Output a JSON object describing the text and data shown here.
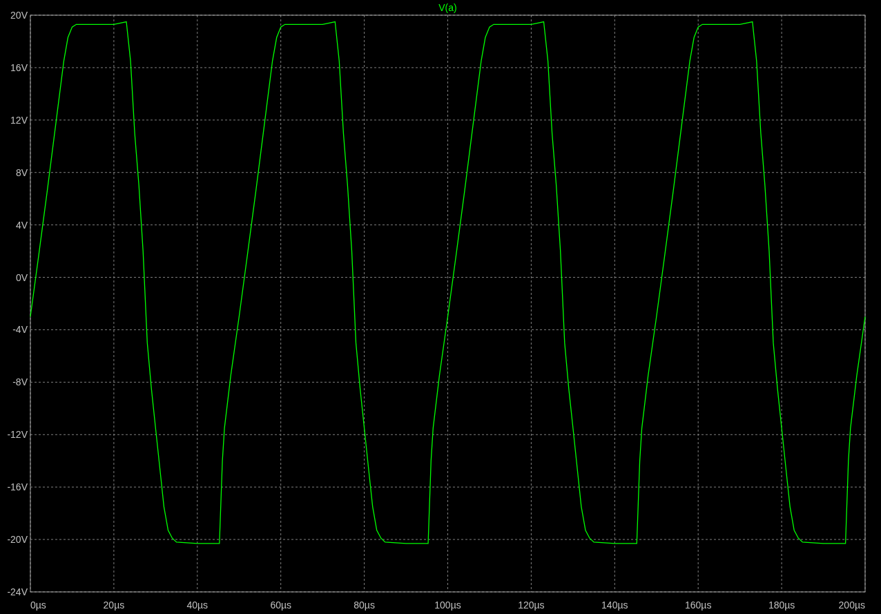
{
  "plot": {
    "chart_data": {
      "type": "line",
      "grid": true,
      "x": [
        0,
        2,
        4,
        6,
        8,
        9,
        10,
        11,
        15,
        20,
        23,
        24,
        25,
        26,
        27,
        28,
        29,
        30,
        31,
        32,
        33,
        34,
        35,
        40,
        45.3,
        46,
        46.5,
        48,
        50,
        52,
        54,
        56,
        58,
        59,
        60,
        61,
        65,
        70,
        73,
        74,
        75,
        76,
        77,
        78,
        79,
        80,
        81,
        82,
        83,
        84,
        85,
        90,
        95.3,
        96,
        96.5,
        98,
        100,
        102,
        104,
        106,
        108,
        109,
        110,
        111,
        115,
        120,
        123,
        124,
        125,
        126,
        127,
        128,
        129,
        130,
        131,
        132,
        133,
        134,
        135,
        140,
        145.3,
        146,
        146.5,
        148,
        150,
        152,
        154,
        156,
        158,
        159,
        160,
        161,
        165,
        170,
        173,
        174,
        175,
        176,
        177,
        178,
        179,
        180,
        181,
        182,
        183,
        184,
        185,
        190,
        195.3,
        196,
        196.5,
        198,
        200
      ],
      "series": [
        {
          "name": "V(a)",
          "color": "#00ff00",
          "values": [
            -3,
            1.7,
            6.5,
            11.5,
            16.5,
            18.3,
            19.1,
            19.3,
            19.3,
            19.3,
            19.5,
            16.5,
            11,
            7,
            2,
            -5,
            -8.5,
            -11.5,
            -14.5,
            -17.5,
            -19.3,
            -19.9,
            -20.2,
            -20.3,
            -20.3,
            -14,
            -11.5,
            -7.5,
            -3,
            1.7,
            6.5,
            11.5,
            16.5,
            18.3,
            19.1,
            19.3,
            19.3,
            19.3,
            19.5,
            16.5,
            11,
            7,
            2,
            -5,
            -8.5,
            -11.5,
            -14.5,
            -17.5,
            -19.3,
            -19.9,
            -20.2,
            -20.3,
            -20.3,
            -14,
            -11.5,
            -7.5,
            -3,
            1.7,
            6.5,
            11.5,
            16.5,
            18.3,
            19.1,
            19.3,
            19.3,
            19.3,
            19.5,
            16.5,
            11,
            7,
            2,
            -5,
            -8.5,
            -11.5,
            -14.5,
            -17.5,
            -19.3,
            -19.9,
            -20.2,
            -20.3,
            -20.3,
            -14,
            -11.5,
            -7.5,
            -3,
            1.7,
            6.5,
            11.5,
            16.5,
            18.3,
            19.1,
            19.3,
            19.3,
            19.3,
            19.5,
            16.5,
            11,
            7,
            2,
            -5,
            -8.5,
            -11.5,
            -14.5,
            -17.5,
            -19.3,
            -19.9,
            -20.2,
            -20.3,
            -20.3,
            -14,
            -11.5,
            -7.5,
            -3
          ]
        }
      ],
      "xlim": [
        0,
        200
      ],
      "ylim": [
        -24,
        20
      ],
      "xticks": [
        {
          "value": 0,
          "label": "0µs"
        },
        {
          "value": 20,
          "label": "20µs"
        },
        {
          "value": 40,
          "label": "40µs"
        },
        {
          "value": 60,
          "label": "60µs"
        },
        {
          "value": 80,
          "label": "80µs"
        },
        {
          "value": 100,
          "label": "100µs"
        },
        {
          "value": 120,
          "label": "120µs"
        },
        {
          "value": 140,
          "label": "140µs"
        },
        {
          "value": 160,
          "label": "160µs"
        },
        {
          "value": 180,
          "label": "180µs"
        },
        {
          "value": 200,
          "label": "200µs"
        }
      ],
      "yticks": [
        {
          "value": 20,
          "label": "20V"
        },
        {
          "value": 16,
          "label": "16V"
        },
        {
          "value": 12,
          "label": "12V"
        },
        {
          "value": 8,
          "label": "8V"
        },
        {
          "value": 4,
          "label": "4V"
        },
        {
          "value": 0,
          "label": "0V"
        },
        {
          "value": -4,
          "label": "-4V"
        },
        {
          "value": -8,
          "label": "-8V"
        },
        {
          "value": -12,
          "label": "-12V"
        },
        {
          "value": -16,
          "label": "-16V"
        },
        {
          "value": -20,
          "label": "-20V"
        },
        {
          "value": -24,
          "label": "-24V"
        }
      ]
    }
  }
}
